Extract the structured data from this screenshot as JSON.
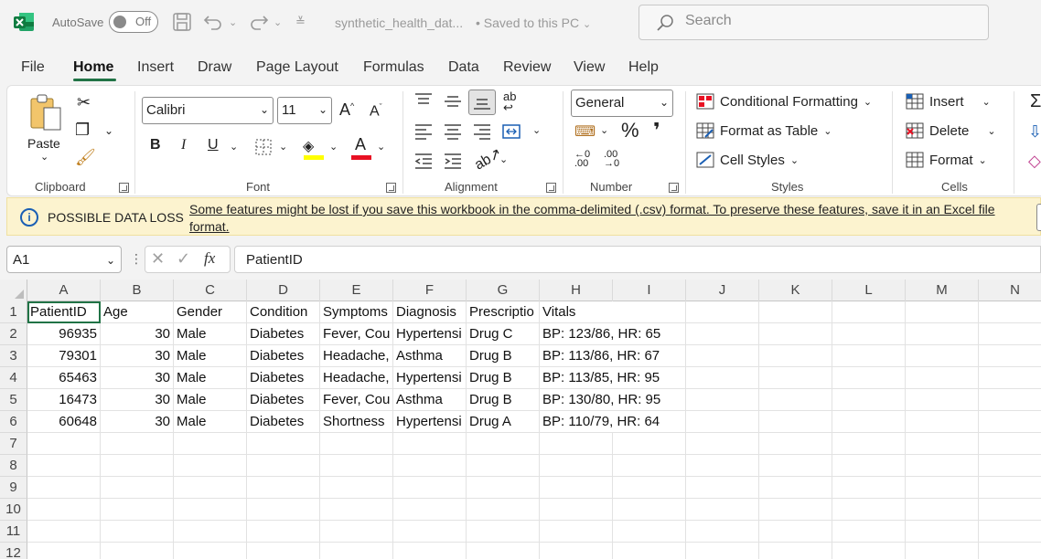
{
  "titlebar": {
    "autosave_label": "AutoSave",
    "autosave_state": "Off",
    "filename": "synthetic_health_dat...",
    "saved_status": "• Saved to this PC",
    "search_placeholder": "Search"
  },
  "tabs": [
    "File",
    "Home",
    "Insert",
    "Draw",
    "Page Layout",
    "Formulas",
    "Data",
    "Review",
    "View",
    "Help"
  ],
  "ribbon": {
    "clipboard": {
      "paste": "Paste",
      "label": "Clipboard"
    },
    "font": {
      "name": "Calibri",
      "size": "11",
      "label": "Font",
      "bold": "B",
      "italic": "I",
      "underline": "U",
      "grow": "A^",
      "shrink": "Aˇ",
      "color_letter": "A"
    },
    "alignment": {
      "label": "Alignment"
    },
    "number": {
      "format": "General",
      "label": "Number",
      "percent": "%",
      "comma": "❜"
    },
    "styles": {
      "conditional": "Conditional Formatting",
      "format_table": "Format as Table",
      "cell_styles": "Cell Styles",
      "label": "Styles"
    },
    "cells": {
      "insert": "Insert",
      "delete": "Delete",
      "format": "Format",
      "label": "Cells"
    }
  },
  "warning": {
    "title": "POSSIBLE DATA LOSS",
    "message": "Some features might be lost if you save this workbook in the comma-delimited (.csv) format. To preserve these features, save it in an Excel file format."
  },
  "formula_bar": {
    "name_box": "A1",
    "fx": "fx",
    "content": "PatientID"
  },
  "grid": {
    "columns": [
      "A",
      "B",
      "C",
      "D",
      "E",
      "F",
      "G",
      "H",
      "I",
      "J",
      "K",
      "L",
      "M",
      "N"
    ],
    "rows": [
      "1",
      "2",
      "3",
      "4",
      "5",
      "6",
      "7",
      "8",
      "9",
      "10",
      "11",
      "12"
    ],
    "header": [
      "PatientID",
      "Age",
      "Gender",
      "Condition",
      "Symptoms",
      "Diagnosis",
      "Prescriptio",
      "Vitals"
    ],
    "data": [
      [
        "96935",
        "30",
        "Male",
        "Diabetes",
        "Fever, Cou",
        "Hypertensi",
        "Drug C",
        "BP: 123/86, HR: 65"
      ],
      [
        "79301",
        "30",
        "Male",
        "Diabetes",
        "Headache,",
        "Asthma",
        "Drug B",
        "BP: 113/86, HR: 67"
      ],
      [
        "65463",
        "30",
        "Male",
        "Diabetes",
        "Headache,",
        "Hypertensi",
        "Drug B",
        "BP: 113/85, HR: 95"
      ],
      [
        "16473",
        "30",
        "Male",
        "Diabetes",
        "Fever, Cou",
        "Asthma",
        "Drug B",
        "BP: 130/80, HR: 95"
      ],
      [
        "60648",
        "30",
        "Male",
        "Diabetes",
        "Shortness",
        "Hypertensi",
        "Drug A",
        "BP: 110/79, HR: 64"
      ]
    ]
  },
  "colors": {
    "accent": "#217346",
    "warning_bg": "#fcf3cf",
    "info": "#1a5fb4"
  }
}
